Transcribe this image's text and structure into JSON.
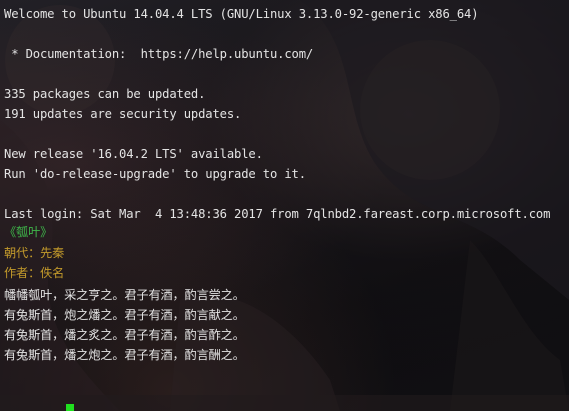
{
  "terminal": {
    "motd": {
      "welcome": "Welcome to Ubuntu 14.04.4 LTS (GNU/Linux 3.13.0-92-generic x86_64)",
      "documentation": " * Documentation:  https://help.ubuntu.com/",
      "packages": "335 packages can be updated.",
      "security": "191 updates are security updates.",
      "new_release": "New release '16.04.2 LTS' available.",
      "upgrade_hint": "Run 'do-release-upgrade' to upgrade to it.",
      "last_login": "Last login: Sat Mar  4 13:48:36 2017 from 7qlnbd2.fareast.corp.microsoft.com"
    },
    "poem": {
      "title": "《瓠叶》",
      "dynasty": "朝代：先秦",
      "author": "作者：佚名",
      "lines": [
        "幡幡瓠叶，采之亨之。君子有酒，酌言尝之。",
        "有兔斯首，炮之燔之。君子有酒，酌言献之。",
        "有兔斯首，燔之炙之。君子有酒，酌言酢之。",
        "有兔斯首，燔之炮之。君子有酒，酌言酬之。"
      ]
    },
    "prompt": {
      "symbol": "~"
    },
    "colors": {
      "text": "#e4e4e4",
      "title": "#3fb64a",
      "meta": "#c39a2b",
      "cursor": "#20e01f",
      "prompt": "#58a6ff"
    }
  }
}
